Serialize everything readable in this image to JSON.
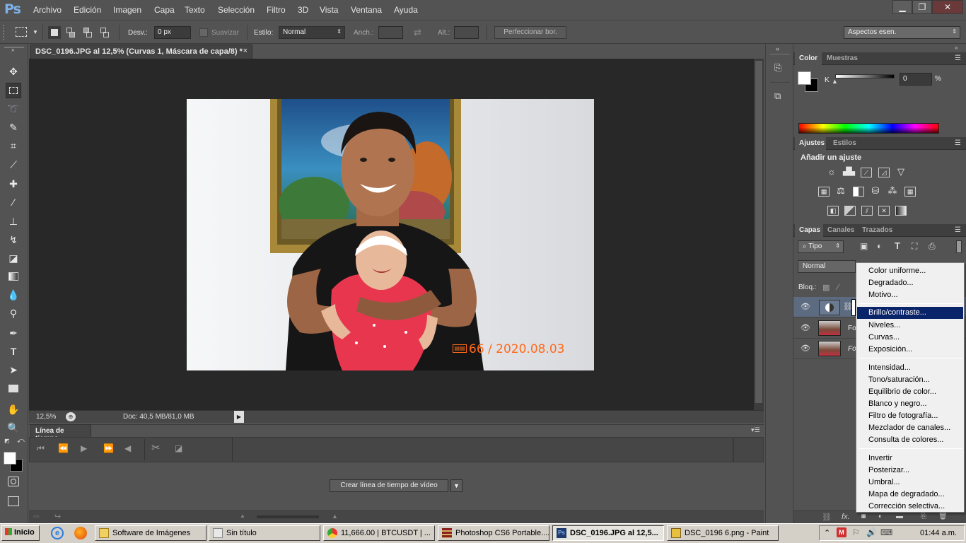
{
  "app": {
    "logo": "Ps"
  },
  "menu": [
    "Archivo",
    "Edición",
    "Imagen",
    "Capa",
    "Texto",
    "Selección",
    "Filtro",
    "3D",
    "Vista",
    "Ventana",
    "Ayuda"
  ],
  "window_buttons": {
    "minimize": "▁",
    "restore": "❐",
    "close": "✕"
  },
  "options": {
    "feather_label": "Desv.:",
    "feather_value": "0 px",
    "antialias_label": "Suavizar",
    "style_label": "Estilo:",
    "style_value": "Normal",
    "width_label": "Anch.:",
    "height_label": "Alt.:",
    "refine_label": "Perfeccionar bor.",
    "workspace_value": "Aspectos esen."
  },
  "document": {
    "tab_title": "DSC_0196.JPG al 12,5% (Curvas 1, Máscara de capa/8) *",
    "tab_close": "×",
    "photo_timestamp": "66 / 2020.08.03",
    "zoom": "12,5%",
    "doc_size": "Doc: 40,5 MB/81,0 MB"
  },
  "timeline": {
    "tab_label": "Línea de tiempo",
    "create_button": "Crear línea de tiempo de vídeo"
  },
  "color_panel": {
    "tabs": [
      "Color",
      "Muestras"
    ],
    "channel_label": "K",
    "value": "0",
    "unit": "%"
  },
  "adjustments_panel": {
    "tabs": [
      "Ajustes",
      "Estilos"
    ],
    "title": "Añadir un ajuste"
  },
  "layers_panel": {
    "tabs": [
      "Capas",
      "Canales",
      "Trazados"
    ],
    "filter_value": "Tipo",
    "blend_mode": "Normal",
    "lock_label": "Bloq.:",
    "layers": [
      {
        "name": "Fo"
      },
      {
        "name": "Fo"
      }
    ],
    "fx_label": "fx."
  },
  "context_menu": {
    "groups": [
      [
        "Color uniforme...",
        "Degradado...",
        "Motivo..."
      ],
      [
        "Brillo/contraste...",
        "Niveles...",
        "Curvas...",
        "Exposición..."
      ],
      [
        "Intensidad...",
        "Tono/saturación...",
        "Equilibrio de color...",
        "Blanco y negro...",
        "Filtro de fotografía...",
        "Mezclador de canales...",
        "Consulta de colores..."
      ],
      [
        "Invertir",
        "Posterizar...",
        "Umbral...",
        "Mapa de degradado...",
        "Corrección selectiva..."
      ]
    ],
    "highlighted": "Brillo/contraste..."
  },
  "taskbar": {
    "start_label": "Inicio",
    "items": [
      {
        "label": "Software de Imágenes",
        "icon_color": "#f0d060"
      },
      {
        "label": "Sin título",
        "icon_color": "#e8e8e8"
      },
      {
        "label": "11,666.00 | BTCUSDT | ...",
        "icon_color": "#3a8ee6"
      },
      {
        "label": "Photoshop CS6 Portable....",
        "icon_color": "#8a2020"
      },
      {
        "label": "DSC_0196.JPG al 12,5...",
        "icon_color": "#1e3a6e"
      },
      {
        "label": "DSC_0196 6.png - Paint",
        "icon_color": "#e8c040"
      }
    ],
    "clock": "01:44 a.m."
  },
  "colors": {
    "highlight": "#0a246a",
    "timestamp": "#ff6a1a",
    "ps_blue": "#7fb0e8"
  }
}
